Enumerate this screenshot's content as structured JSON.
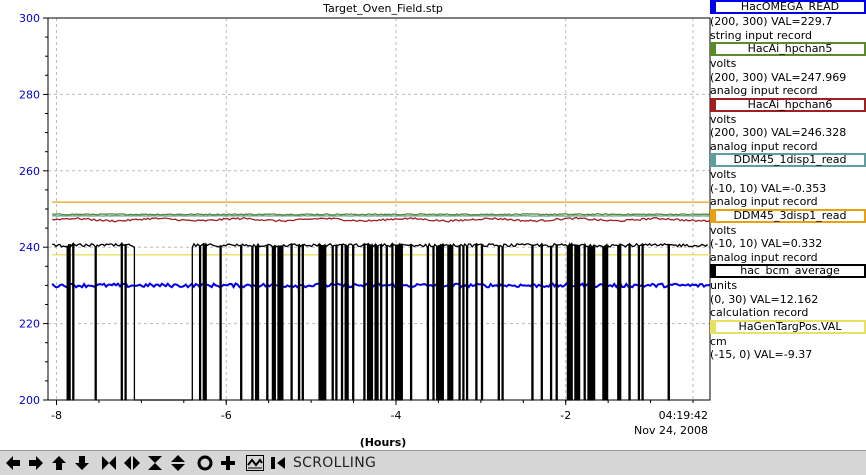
{
  "chart_data": {
    "type": "line",
    "title": "Target_Oven_Field.stp",
    "xlabel": "(Hours)",
    "ylabel": "",
    "xlim": [
      -8.1,
      -0.3
    ],
    "ylim": [
      200,
      300
    ],
    "y_ticks": [
      200,
      220,
      240,
      260,
      280,
      300
    ],
    "x_ticks": [
      -8,
      -6,
      -4,
      -2
    ],
    "time_label": "04:19:42",
    "date_label": "Nov 24, 2008",
    "grid": true,
    "series": [
      {
        "name": "HacOMEGA_READ",
        "color": "#0000ee",
        "range": "(200, 300)",
        "value": "VAL=229.7",
        "units": "",
        "record": "string input record",
        "level": 230.0,
        "noise": 0.5
      },
      {
        "name": "HacAi_hpchan5",
        "color": "#5a8a2a",
        "range": "(200, 300)",
        "value": "VAL=247.969",
        "units": "volts",
        "record": "analog input record",
        "level": 248.6,
        "noise": 0.15
      },
      {
        "name": "HacAi_hpchan6",
        "color": "#a02020",
        "range": "(200, 300)",
        "value": "VAL=246.328",
        "units": "volts",
        "record": "analog input record",
        "level": 247.2,
        "noise": 0.25
      },
      {
        "name": "DDM45_1disp1_read",
        "color": "#5f9e9e",
        "range": "(-10, 10)",
        "value": "VAL=-0.353",
        "units": "volts",
        "record": "analog input record",
        "level": 248.2,
        "noise": 0.05
      },
      {
        "name": "DDM45_3disp1_read",
        "color": "#e8a010",
        "range": "(-10, 10)",
        "value": "VAL=0.332",
        "units": "volts",
        "record": "analog input record",
        "level": 251.8,
        "noise": 0.0
      },
      {
        "name": "hac_bcm_average",
        "color": "#000000",
        "range": "(0, 30)",
        "value": "VAL=12.162",
        "units": "units",
        "record": "calculation record",
        "level": 240.5,
        "noise": 0.4
      },
      {
        "name": "HaGenTargPos.VAL",
        "color": "#e8e060",
        "range": "(-15, 0)",
        "value": "VAL=-9.37",
        "units": "cm",
        "record": "",
        "level": 238.0,
        "noise": 0.0
      }
    ]
  },
  "toolbar": {
    "icons": [
      "arrow-left-icon",
      "arrow-right-icon",
      "arrow-up-icon",
      "arrow-down-icon",
      "expand-horizontal-icon",
      "compress-horizontal-icon",
      "expand-vertical-icon",
      "compress-vertical-icon",
      "circle-icon",
      "plus-icon",
      "waveform-icon",
      "pause-icon"
    ],
    "status": "SCROLLING"
  }
}
